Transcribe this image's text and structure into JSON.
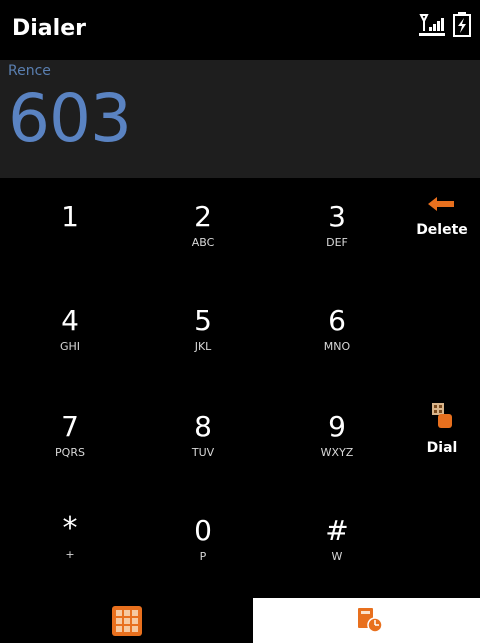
{
  "app": {
    "title": "Dialer"
  },
  "status": {
    "signal_icon": "signal-icon",
    "battery_icon": "battery-charging-icon"
  },
  "display": {
    "contact_name": "Rence",
    "number": "603"
  },
  "keypad": {
    "keys": [
      {
        "digit": "1",
        "letters": ""
      },
      {
        "digit": "2",
        "letters": "ABC"
      },
      {
        "digit": "3",
        "letters": "DEF"
      },
      {
        "digit": "4",
        "letters": "GHI"
      },
      {
        "digit": "5",
        "letters": "JKL"
      },
      {
        "digit": "6",
        "letters": "MNO"
      },
      {
        "digit": "7",
        "letters": "PQRS"
      },
      {
        "digit": "8",
        "letters": "TUV"
      },
      {
        "digit": "9",
        "letters": "WXYZ"
      },
      {
        "digit": "*",
        "letters": "+"
      },
      {
        "digit": "0",
        "letters": "P"
      },
      {
        "digit": "#",
        "letters": "W"
      }
    ]
  },
  "actions": {
    "delete_label": "Delete",
    "dial_label": "Dial"
  },
  "tabs": {
    "keypad_icon": "keypad-grid-icon",
    "log_icon": "call-log-icon"
  },
  "colors": {
    "accent_orange": "#e8701e",
    "number_blue": "#5a83c2",
    "display_bg": "#1e1e1e"
  }
}
